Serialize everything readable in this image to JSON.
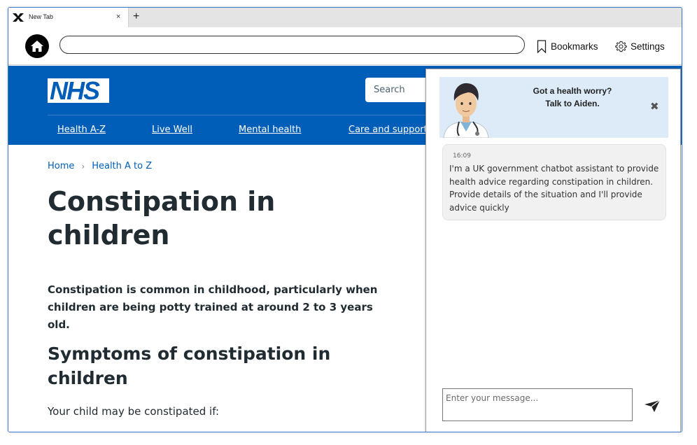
{
  "browser": {
    "tab_title": "New Tab",
    "tab_close": "×",
    "new_tab": "+",
    "url": "",
    "bookmarks_label": "Bookmarks",
    "settings_label": "Settings"
  },
  "site": {
    "logo_text": "NHS",
    "search_placeholder": "Search",
    "nav": [
      "Health A-Z",
      "Live Well",
      "Mental health",
      "Care and support"
    ],
    "breadcrumb": [
      "Home",
      "Health A to Z"
    ],
    "breadcrumb_separator": "›",
    "title": "Constipation in children",
    "lead": "Constipation is common in childhood, particularly when children are being potty trained at around 2 to 3 years old.",
    "section_heading": "Symptoms of constipation in children",
    "body_text": "Your child may be constipated if:",
    "brand_color": "#005eb8"
  },
  "chatbot": {
    "banner_line1": "Got a health worry?",
    "banner_line2": "Talk to Aiden.",
    "close_glyph": "✖",
    "message_time": "16:09",
    "message_text": "I'm a UK government chatbot assistant to provide health advice regarding constipation in children. Provide details of the situation and I'll provide advice quickly",
    "input_placeholder": "Enter your message..."
  }
}
